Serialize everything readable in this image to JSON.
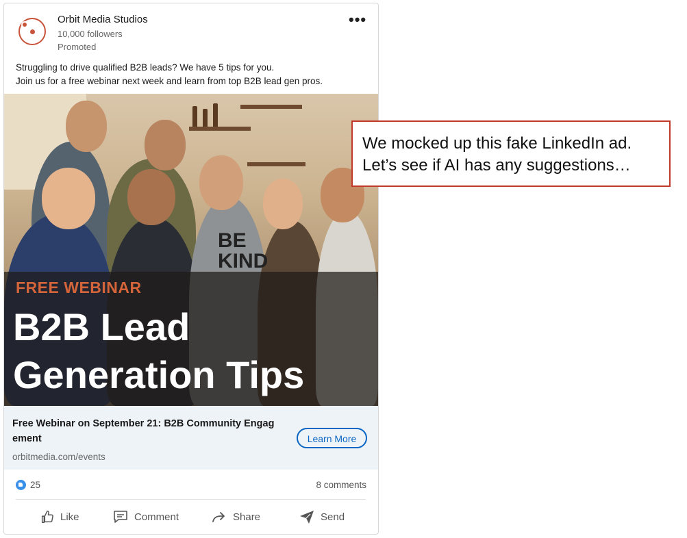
{
  "post": {
    "company": "Orbit Media Studios",
    "followers": "10,000 followers",
    "promoted": "Promoted",
    "more_icon": "•••",
    "text_line1": "Struggling to drive qualified B2B leads? We have 5 tips for you.",
    "text_line2": "Join us for a free webinar next week and learn from top B2B lead gen pros.",
    "image": {
      "tag": "FREE WEBINAR",
      "headline_line1": "B2B Lead",
      "headline_line2": "Generation Tips",
      "shirt_text": "BE KIND"
    },
    "cta": {
      "title": "Free Webinar on September 21: B2B Community Engag ement",
      "url": "orbitmedia.com/events",
      "button": "Learn More"
    },
    "reactions_count": "25",
    "comments": "8 comments",
    "actions": {
      "like": "Like",
      "comment": "Comment",
      "share": "Share",
      "send": "Send"
    }
  },
  "annotation": {
    "line1": "We mocked up this fake LinkedIn ad.",
    "line2": "Let’s see if AI has any suggestions…"
  },
  "colors": {
    "brand": "#c7533a",
    "linkedin_blue": "#0a66c2",
    "note_border": "#c0392b"
  }
}
